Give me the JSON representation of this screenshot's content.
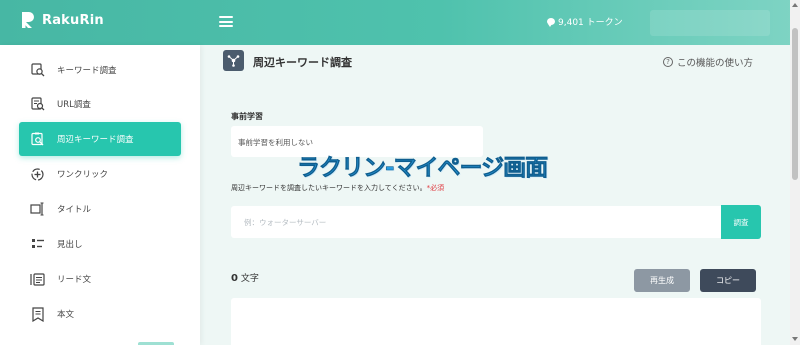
{
  "app": {
    "name": "RakuRin"
  },
  "header": {
    "tokens": "9,401 トークン"
  },
  "sidebar": {
    "items": [
      {
        "label": "キーワード調査",
        "icon": "keyword-search-icon"
      },
      {
        "label": "URL調査",
        "icon": "url-search-icon"
      },
      {
        "label": "周辺キーワード調査",
        "icon": "related-keyword-icon",
        "active": true
      },
      {
        "label": "ワンクリック",
        "icon": "one-click-icon"
      },
      {
        "label": "タイトル",
        "icon": "title-icon"
      },
      {
        "label": "見出し",
        "icon": "heading-icon"
      },
      {
        "label": "リード文",
        "icon": "lead-text-icon"
      },
      {
        "label": "本文",
        "icon": "body-text-icon"
      }
    ]
  },
  "main": {
    "title": "周辺キーワード調査",
    "help_link": "この機能の使い方",
    "pretraining": {
      "label": "事前学習",
      "value": "事前学習を利用しない"
    },
    "keyword": {
      "label": "周辺キーワードを調査したいキーワードを入力してください。",
      "required": "*必須",
      "placeholder": "例：ウォーターサーバー",
      "button": "調査"
    },
    "count": {
      "value": "0",
      "unit": "文字"
    },
    "regenerate_button": "再生成",
    "copy_button": "コピー"
  },
  "overlay": {
    "text": "ラクリン-マイページ画面"
  },
  "colors": {
    "accent": "#27c6ae",
    "header": "#4fc2ad",
    "copy": "#3e4a5b",
    "regenerate": "#8d98a3"
  }
}
